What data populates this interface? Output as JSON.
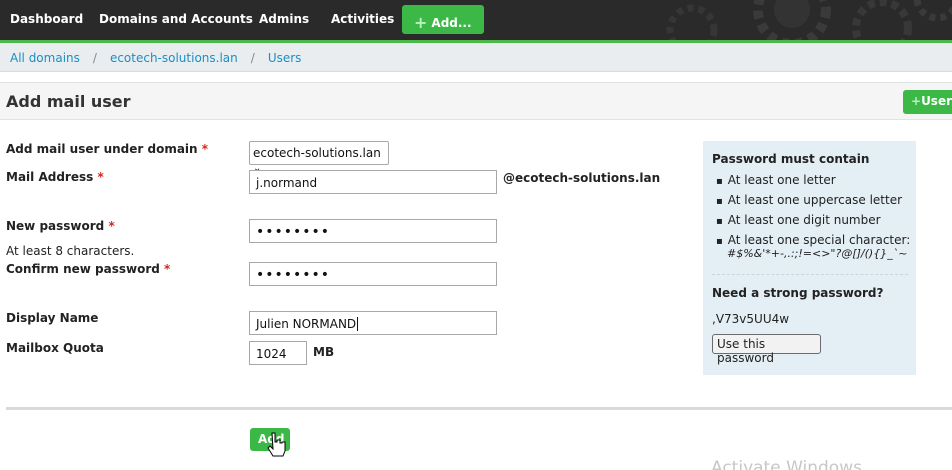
{
  "nav": {
    "items": [
      "Dashboard",
      "Domains and Accounts",
      "Admins",
      "Activities"
    ],
    "add_label": "Add..."
  },
  "breadcrumb": [
    "All domains",
    "ecotech-solutions.lan",
    "Users"
  ],
  "page": {
    "title": "Add mail user",
    "user_button": "User"
  },
  "form": {
    "domain_label": "Add mail user under domain",
    "domain_value": "ecotech-solutions.lan",
    "mail_label": "Mail Address",
    "mail_value": "j.normand",
    "mail_suffix": "@ecotech-solutions.lan",
    "password_label": "New password",
    "password_value": "••••••••",
    "password_hint": "At least 8 characters.",
    "confirm_label": "Confirm new password",
    "confirm_value": "••••••••",
    "display_label": "Display Name",
    "display_value": "Julien NORMAND",
    "quota_label": "Mailbox Quota",
    "quota_value": "1024",
    "quota_unit": "MB",
    "required_mark": "*",
    "submit_label": "Add"
  },
  "panel": {
    "title": "Password must contain",
    "rules": [
      "At least one letter",
      "At least one uppercase letter",
      "At least one digit number",
      "At least one special character:"
    ],
    "special_chars": "#$%&'*+-,.:;!=<>\"?@[]/(){}_`~",
    "strong_title": "Need a strong password?",
    "generated": ",V73v5UU4w",
    "use_button": "Use this password"
  },
  "watermark": "Activate Windows",
  "colors": {
    "nav_bg": "#2a2a2a",
    "accent_green": "#3bb845",
    "link_blue": "#1a8fc4",
    "required_red": "#d9261c",
    "panel_bg": "#e4eef5"
  },
  "icons": [
    "plus-icon",
    "chevron-down-icon",
    "hand-cursor-icon",
    "gears-background"
  ]
}
